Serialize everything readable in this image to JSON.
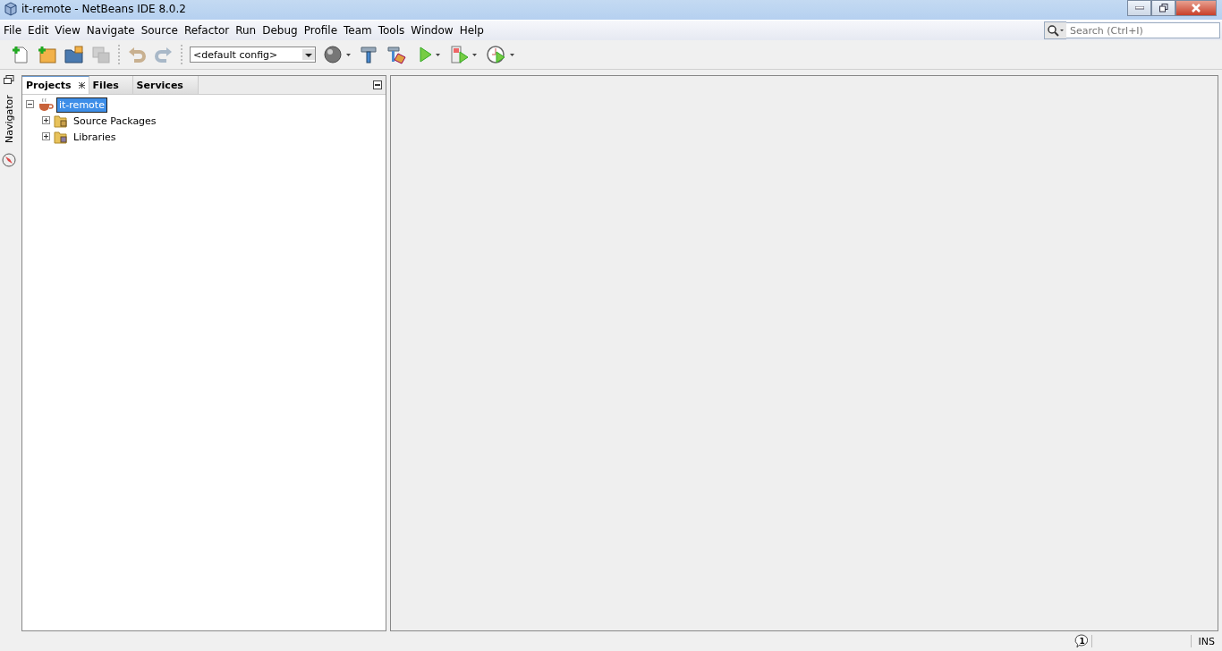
{
  "window": {
    "title": "it-remote - NetBeans IDE 8.0.2"
  },
  "menu": [
    "File",
    "Edit",
    "View",
    "Navigate",
    "Source",
    "Refactor",
    "Run",
    "Debug",
    "Profile",
    "Team",
    "Tools",
    "Window",
    "Help"
  ],
  "search": {
    "placeholder": "Search (Ctrl+I)"
  },
  "toolbar": {
    "config": "<default config>"
  },
  "side_strip": {
    "label": "Navigator"
  },
  "tabs": [
    {
      "label": "Projects",
      "selected": true
    },
    {
      "label": "Files",
      "selected": false
    },
    {
      "label": "Services",
      "selected": false
    }
  ],
  "tree": [
    {
      "label": "it-remote",
      "kind": "project",
      "expanded": true,
      "selected": true,
      "children": [
        {
          "label": "Source Packages",
          "kind": "packages",
          "expanded": false,
          "selected": false
        },
        {
          "label": "Libraries",
          "kind": "libraries",
          "expanded": false,
          "selected": false
        }
      ]
    }
  ],
  "status_bar": {
    "notifications": "1",
    "mode": "INS"
  }
}
